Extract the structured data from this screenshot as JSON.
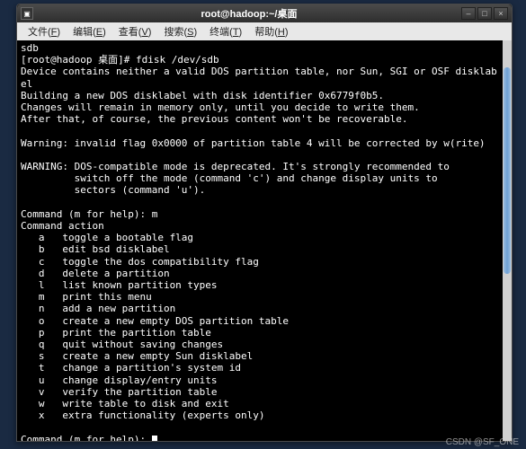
{
  "title": "root@hadoop:~/桌面",
  "window_controls": {
    "min": "–",
    "max": "□",
    "close": "×"
  },
  "menu": [
    {
      "label": "文件",
      "key": "F"
    },
    {
      "label": "编辑",
      "key": "E"
    },
    {
      "label": "查看",
      "key": "V"
    },
    {
      "label": "搜索",
      "key": "S"
    },
    {
      "label": "终端",
      "key": "T"
    },
    {
      "label": "帮助",
      "key": "H"
    }
  ],
  "prompt_line": {
    "pre": "[root@hadoop 桌面]# ",
    "cmd": "fdisk /dev/sdb"
  },
  "lines": [
    "sdb",
    {
      "_prompt": true
    },
    "Device contains neither a valid DOS partition table, nor Sun, SGI or OSF disklab",
    "el",
    "Building a new DOS disklabel with disk identifier 0x6779f0b5.",
    "Changes will remain in memory only, until you decide to write them.",
    "After that, of course, the previous content won't be recoverable.",
    "",
    "Warning: invalid flag 0x0000 of partition table 4 will be corrected by w(rite)",
    "",
    "WARNING: DOS-compatible mode is deprecated. It's strongly recommended to",
    "         switch off the mode (command 'c') and change display units to",
    "         sectors (command 'u').",
    "",
    "Command (m for help): m",
    "Command action",
    "   a   toggle a bootable flag",
    "   b   edit bsd disklabel",
    "   c   toggle the dos compatibility flag",
    "   d   delete a partition",
    "   l   list known partition types",
    "   m   print this menu",
    "   n   add a new partition",
    "   o   create a new empty DOS partition table",
    "   p   print the partition table",
    "   q   quit without saving changes",
    "   s   create a new empty Sun disklabel",
    "   t   change a partition's system id",
    "   u   change display/entry units",
    "   v   verify the partition table",
    "   w   write table to disk and exit",
    "   x   extra functionality (experts only)",
    "",
    "Command (m for help): "
  ],
  "watermark": "CSDN @SF_ONE"
}
